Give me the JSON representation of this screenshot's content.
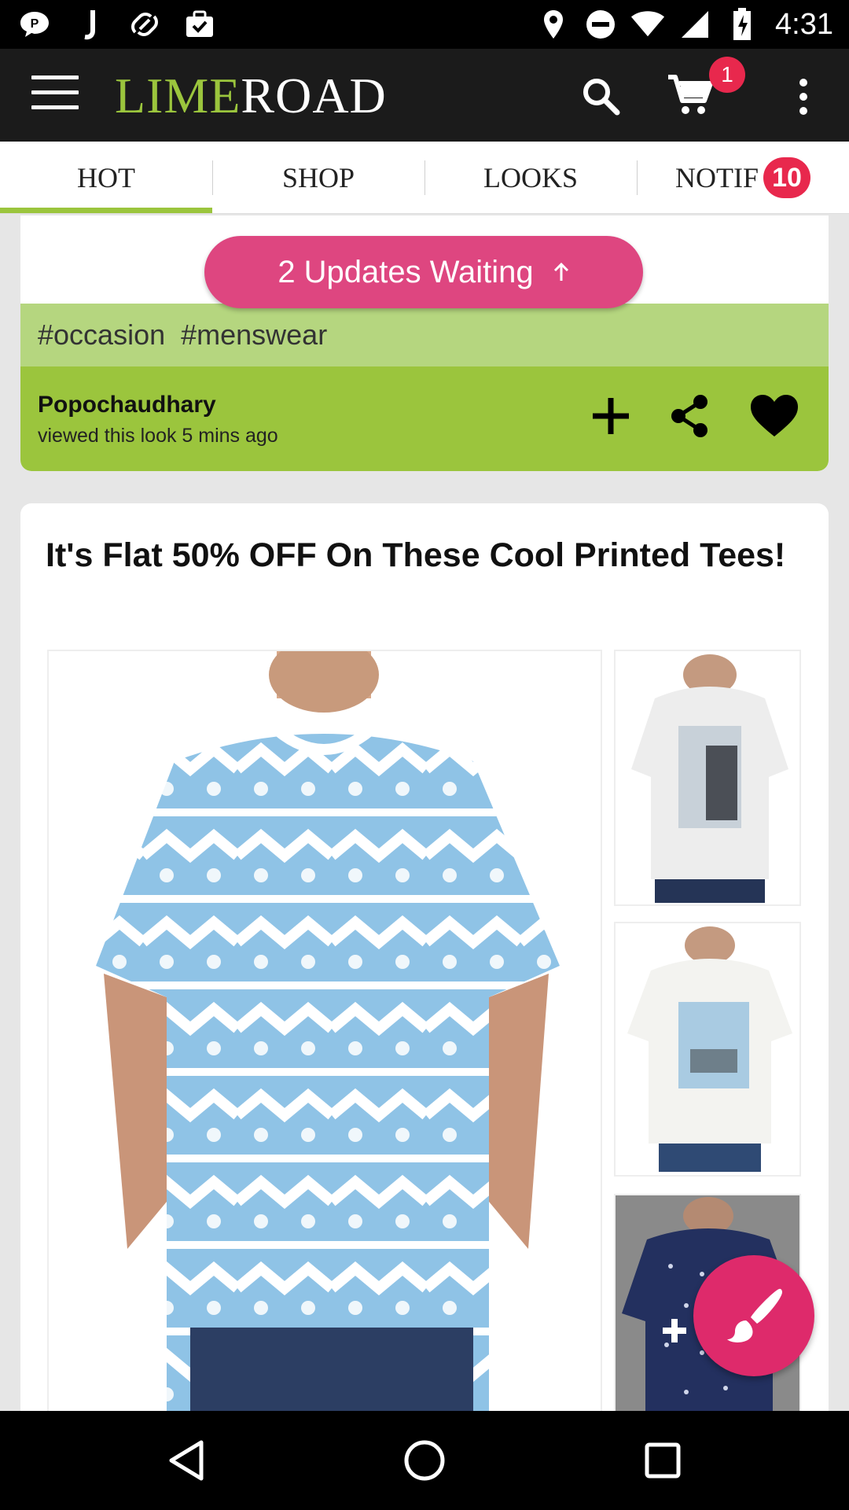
{
  "status_bar": {
    "time": "4:31",
    "left_icons": [
      "chat-bubble-icon",
      "j-icon",
      "link-icon",
      "briefcase-check-icon"
    ],
    "right_icons": [
      "location-pin-icon",
      "do-not-disturb-icon",
      "wifi-icon",
      "signal-icon",
      "battery-charging-icon"
    ]
  },
  "toolbar": {
    "menu_icon": "hamburger-menu-icon",
    "logo_lime": "LIME",
    "logo_road": "ROAD",
    "search_icon": "search-icon",
    "cart_icon": "cart-icon",
    "cart_count": "1",
    "more_icon": "more-vert-icon"
  },
  "tabs": [
    {
      "label": "HOT",
      "active": true
    },
    {
      "label": "SHOP",
      "active": false
    },
    {
      "label": "LOOKS",
      "active": false
    },
    {
      "label": "NOTIF",
      "active": false,
      "badge": "10"
    }
  ],
  "updates_banner": {
    "label": "2 Updates Waiting",
    "icon": "arrow-up-icon"
  },
  "look_card": {
    "tags": [
      "#occasion",
      "#menswear"
    ],
    "viewer_name": "Popochaudhary",
    "viewer_activity": "viewed this look 5 mins ago",
    "actions": [
      "plus-icon",
      "share-icon",
      "heart-icon"
    ]
  },
  "promo_card": {
    "title": "It's Flat 50% OFF On These Cool Printed Tees!",
    "main_image": "light-blue-zigzag-skull-print-tee",
    "thumbnails": [
      "white-graphic-print-tee",
      "white-photo-print-tee",
      "navy-dotted-tee"
    ]
  },
  "fab": {
    "icon": "paintbrush-icon"
  },
  "nav_bar": {
    "icons": [
      "back-triangle-icon",
      "home-circle-icon",
      "recents-square-icon"
    ]
  },
  "colors": {
    "lime": "#9bc53d",
    "lime_light": "#b5d67f",
    "pink": "#de4680",
    "badge_red": "#e8284d",
    "toolbar": "#1b1b1b"
  }
}
